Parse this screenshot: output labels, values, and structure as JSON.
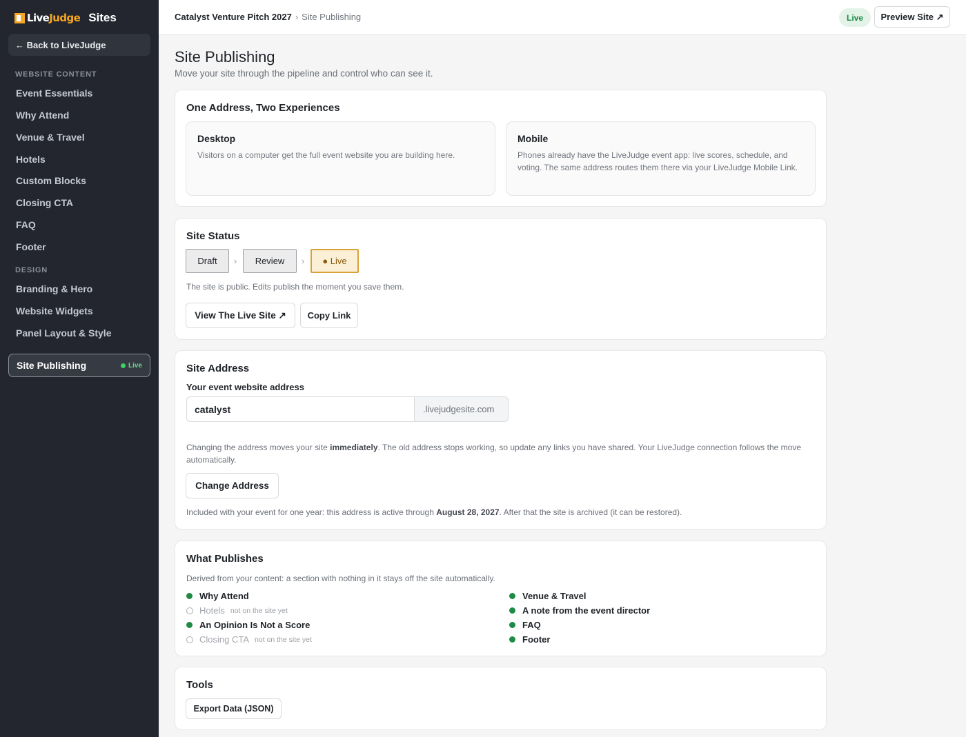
{
  "brand": {
    "logo_live": "Live",
    "logo_judge": "Judge",
    "app": "Sites"
  },
  "sidebar": {
    "back_label": "← Back to LiveJudge",
    "section_content": "WEBSITE CONTENT",
    "content_items": [
      "Event Essentials",
      "Why Attend",
      "Venue & Travel",
      "Hotels",
      "Custom Blocks",
      "Closing CTA",
      "FAQ",
      "Footer"
    ],
    "section_design": "DESIGN",
    "design_items": [
      "Branding & Hero",
      "Website Widgets",
      "Panel Layout & Style"
    ],
    "active_item": {
      "label": "Site Publishing",
      "badge": "Live"
    }
  },
  "topbar": {
    "event": "Catalyst Venture Pitch 2027",
    "separator": "›",
    "page": "Site Publishing",
    "status": "Live",
    "preview_label": "Preview Site ↗"
  },
  "header": {
    "title": "Site Publishing",
    "subtitle": "Move your site through the pipeline and control who can see it."
  },
  "experiences": {
    "title": "One Address, Two Experiences",
    "desktop": {
      "title": "Desktop",
      "text": "Visitors on a computer get the full event website you are building here."
    },
    "mobile": {
      "title": "Mobile",
      "text": "Phones already have the LiveJudge event app: live scores, schedule, and voting. The same address routes them there via your LiveJudge Mobile Link."
    }
  },
  "status": {
    "title": "Site Status",
    "stages": [
      "Draft",
      "Review",
      "● Live"
    ],
    "current_stage": "Live",
    "note": "The site is public. Edits publish the moment you save them.",
    "view_label": "View The Live Site ↗",
    "copy_label": "Copy Link"
  },
  "address": {
    "title": "Site Address",
    "field_label": "Your event website address",
    "value": "catalyst",
    "suffix": ".livejudgesite.com",
    "note_before": "Changing the address moves your site ",
    "note_bold": "immediately",
    "note_after": ". The old address stops working, so update any links you have shared. Your LiveJudge connection follows the move automatically.",
    "change_label": "Change Address",
    "included_before": "Included with your event for one year: this address is active through ",
    "included_date": "August 28, 2027",
    "included_after": ". After that the site is archived (it can be restored)."
  },
  "publishes": {
    "title": "What Publishes",
    "subtitle": "Derived from your content: a section with nothing in it stays off the site automatically.",
    "off_hint": "not on the site yet",
    "left": [
      {
        "label": "Why Attend",
        "published": true
      },
      {
        "label": "Hotels",
        "published": false
      },
      {
        "label": "An Opinion Is Not a Score",
        "published": true
      },
      {
        "label": "Closing CTA",
        "published": false
      }
    ],
    "right": [
      {
        "label": "Venue & Travel",
        "published": true
      },
      {
        "label": "A note from the event director",
        "published": true
      },
      {
        "label": "FAQ",
        "published": true
      },
      {
        "label": "Footer",
        "published": true
      }
    ]
  },
  "tools": {
    "title": "Tools",
    "export_label": "Export Data (JSON)"
  }
}
